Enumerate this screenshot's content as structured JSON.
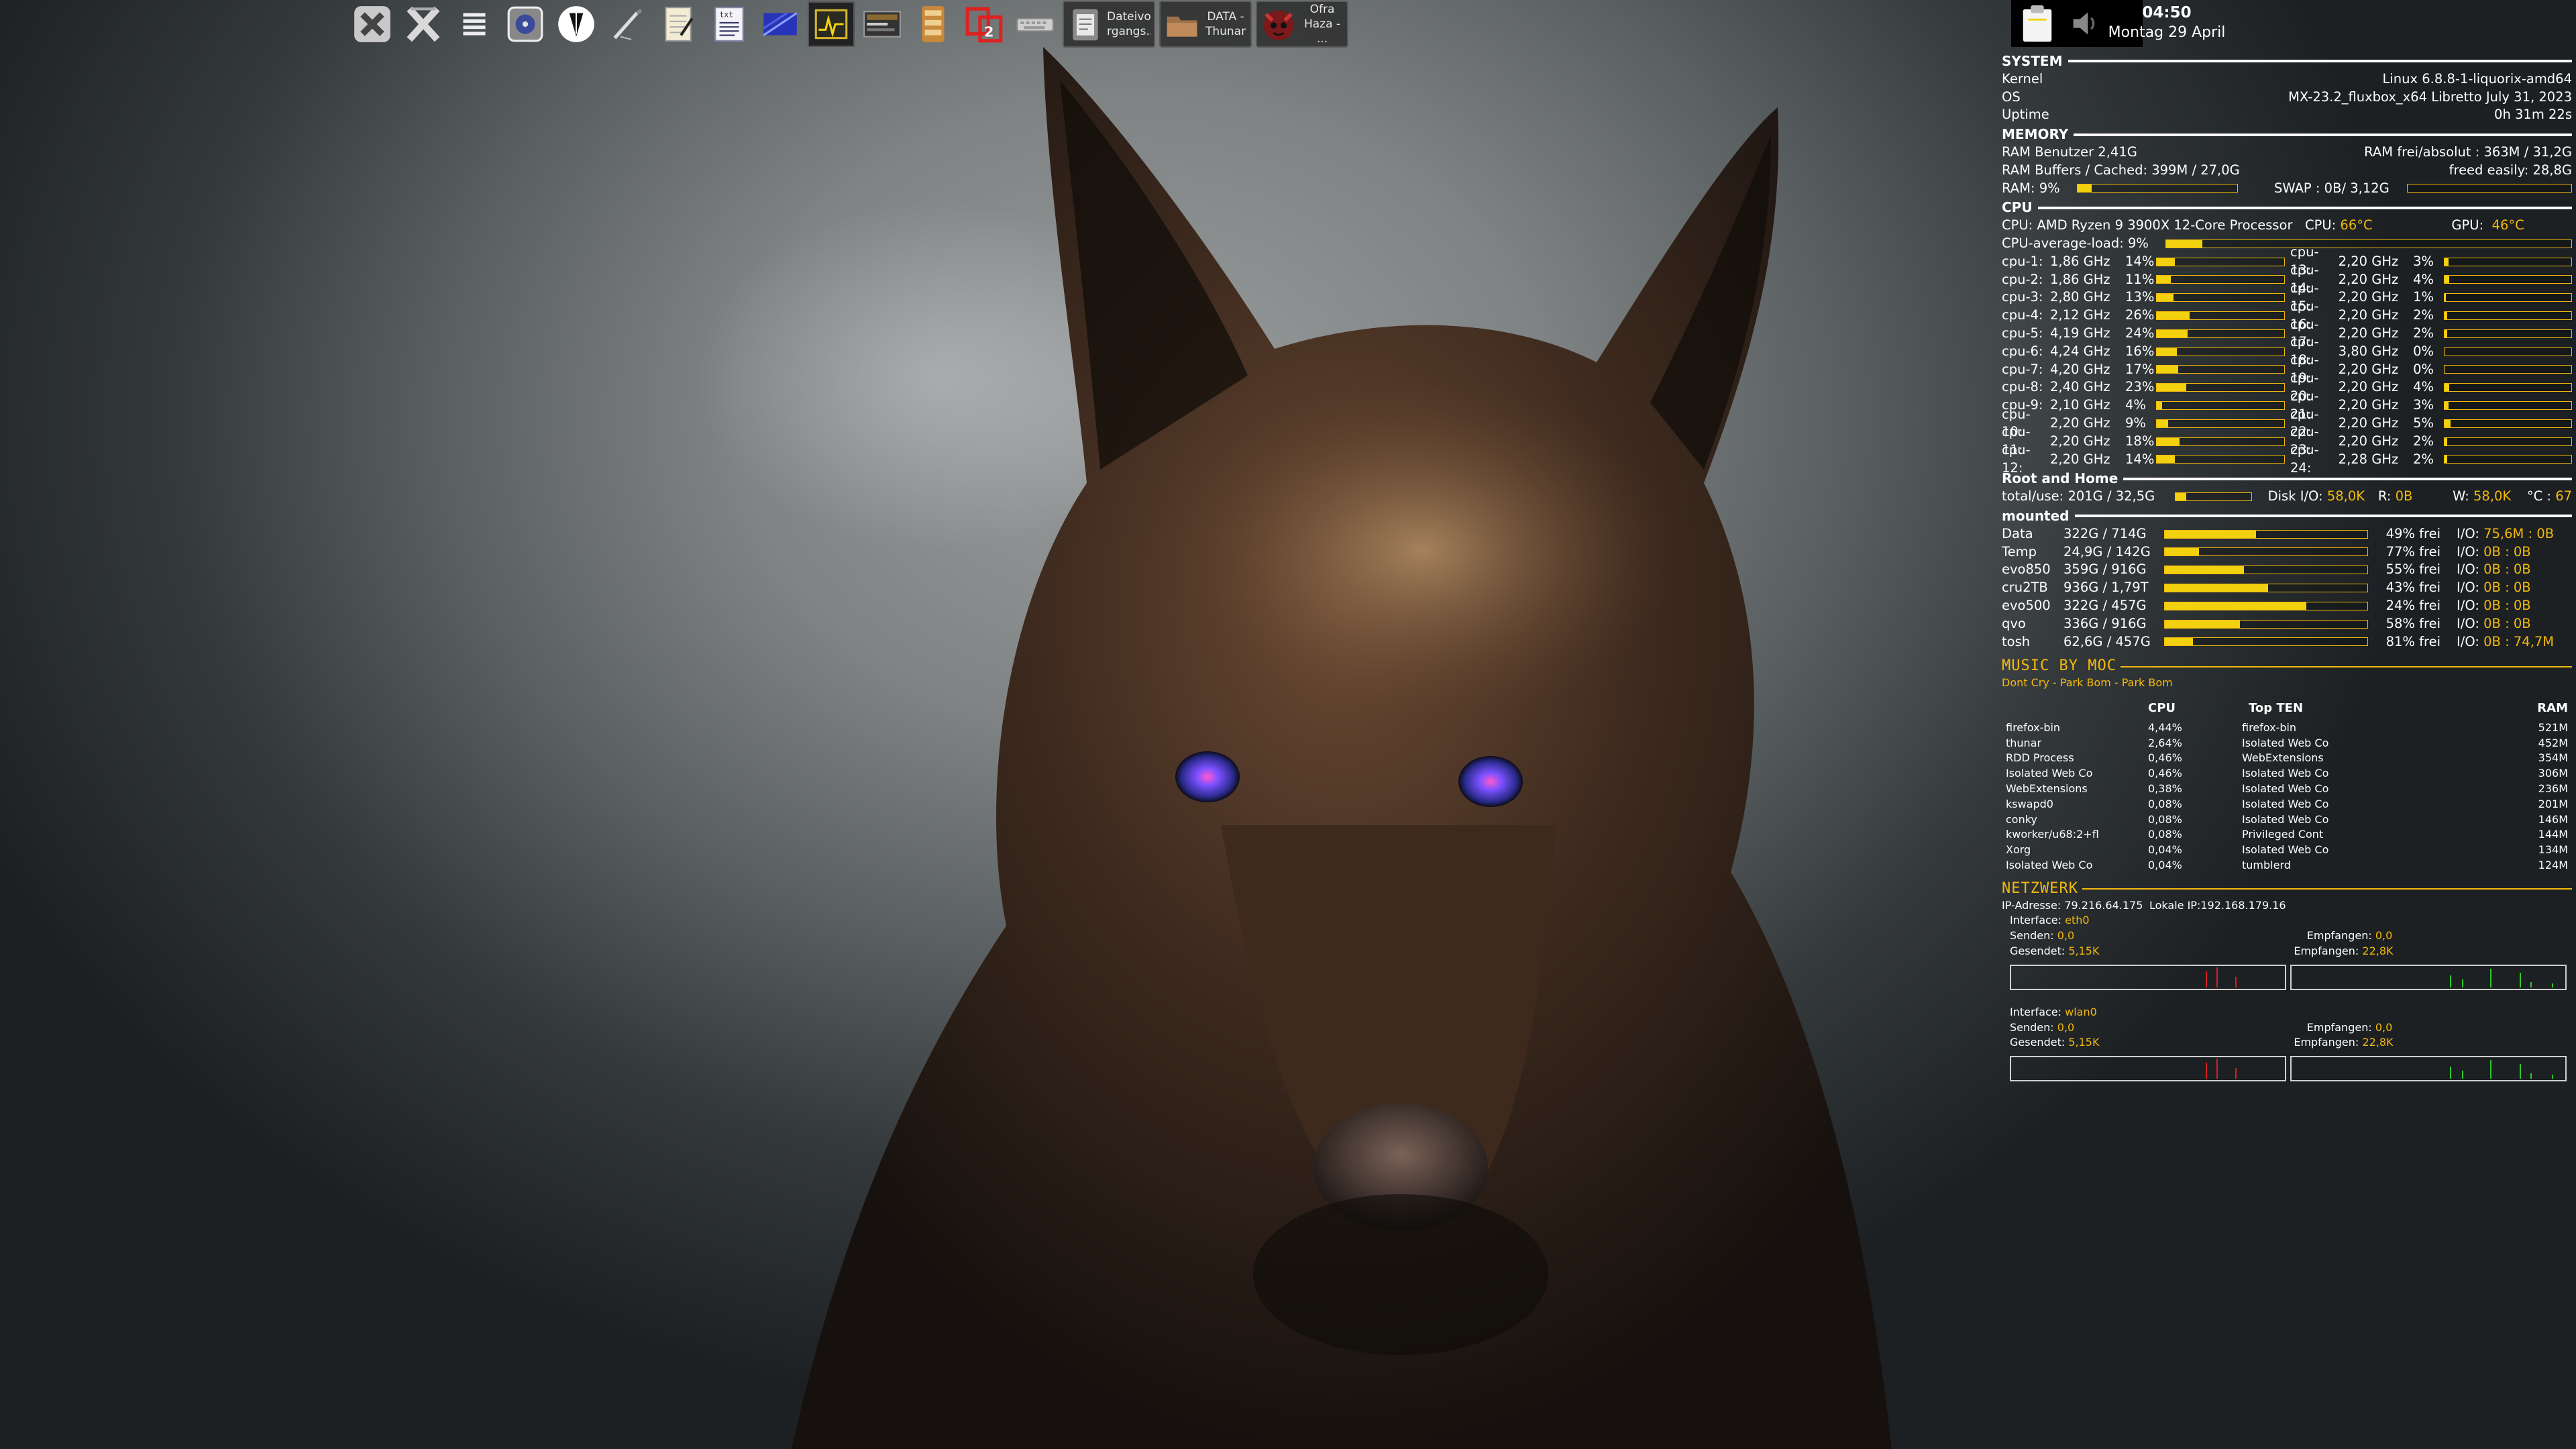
{
  "taskbar": {
    "launchers": [
      "xfce-settings-icon",
      "x-tools-icon",
      "menu-list-icon",
      "media-player-icon",
      "feather-editor-icon",
      "pen-tool-icon",
      "notepad-icon",
      "text-editor-icon",
      "blue-image-icon",
      "system-monitor-icon",
      "terminal-panel-icon",
      "archive-icon",
      "image-editor-icon",
      "keyboard-icon"
    ],
    "tasks": [
      {
        "label": "Dateivo-rgangs...",
        "icon": "file-operations-icon"
      },
      {
        "label": "DATA - Thunar",
        "icon": "folder-icon"
      },
      {
        "label": "Ofra Haza - ...",
        "icon": "music-player-icon"
      }
    ]
  },
  "clock": {
    "time": "04:50",
    "date": "Montag 29 April"
  },
  "conky": {
    "system": {
      "title": "SYSTEM",
      "kernel_label": "Kernel",
      "kernel": "Linux 6.8.8-1-liquorix-amd64",
      "os_label": "OS",
      "os": "MX-23.2_fluxbox_x64 Libretto July 31, 2023",
      "uptime_label": "Uptime",
      "uptime": "0h 31m 22s"
    },
    "memory": {
      "title": "MEMORY",
      "ram_user": "RAM Benutzer 2,41G",
      "ram_free": "RAM frei/absolut : 363M / 31,2G",
      "buffers": "RAM Buffers / Cached: 399M / 27,0G",
      "freed": "freed easily: 28,8G",
      "ram_label": "RAM: 9%",
      "ram_pct": 9,
      "swap_label": "SWAP : 0B/ 3,12G",
      "swap_pct": 0
    },
    "cpu": {
      "title": "CPU",
      "model": "CPU: AMD Ryzen 9 3900X 12-Core Processor",
      "cpu_temp_label": "CPU:",
      "cpu_temp": "66°C",
      "gpu_temp_label": "GPU:",
      "gpu_temp": "46°C",
      "avg_label": "CPU-average-load: 9%",
      "avg_pct": 9,
      "cores": [
        {
          "name": "cpu-1:",
          "freq": "1,86 GHz",
          "pct": 14
        },
        {
          "name": "cpu-13:",
          "freq": "2,20 GHz",
          "pct": 3
        },
        {
          "name": "cpu-2:",
          "freq": "1,86 GHz",
          "pct": 11
        },
        {
          "name": "cpu-14:",
          "freq": "2,20 GHz",
          "pct": 4
        },
        {
          "name": "cpu-3:",
          "freq": "2,80 GHz",
          "pct": 13
        },
        {
          "name": "cpu-15:",
          "freq": "2,20 GHz",
          "pct": 1
        },
        {
          "name": "cpu-4:",
          "freq": "2,12 GHz",
          "pct": 26
        },
        {
          "name": "cpu-16:",
          "freq": "2,20 GHz",
          "pct": 2
        },
        {
          "name": "cpu-5:",
          "freq": "4,19 GHz",
          "pct": 24
        },
        {
          "name": "cpu-17:",
          "freq": "2,20 GHz",
          "pct": 2
        },
        {
          "name": "cpu-6:",
          "freq": "4,24 GHz",
          "pct": 16
        },
        {
          "name": "cpu-18:",
          "freq": "3,80 GHz",
          "pct": 0
        },
        {
          "name": "cpu-7:",
          "freq": "4,20 GHz",
          "pct": 17
        },
        {
          "name": "cpu-19:",
          "freq": "2,20 GHz",
          "pct": 0
        },
        {
          "name": "cpu-8:",
          "freq": "2,40 GHz",
          "pct": 23
        },
        {
          "name": "cpu-20:",
          "freq": "2,20 GHz",
          "pct": 4
        },
        {
          "name": "cpu-9:",
          "freq": "2,10 GHz",
          "pct": 4
        },
        {
          "name": "cpu-21:",
          "freq": "2,20 GHz",
          "pct": 3
        },
        {
          "name": "cpu-10:",
          "freq": "2,20 GHz",
          "pct": 9
        },
        {
          "name": "cpu-22:",
          "freq": "2,20 GHz",
          "pct": 5
        },
        {
          "name": "cpu-11:",
          "freq": "2,20 GHz",
          "pct": 18
        },
        {
          "name": "cpu-23:",
          "freq": "2,20 GHz",
          "pct": 2
        },
        {
          "name": "cpu-12:",
          "freq": "2,20 GHz",
          "pct": 14
        },
        {
          "name": "cpu-24:",
          "freq": "2,28 GHz",
          "pct": 2
        }
      ]
    },
    "root": {
      "title": "Root and Home",
      "total": "total/use: 201G / 32,5G",
      "use_pct": 14,
      "diskio_label": "Disk I/O:",
      "diskio": "58,0K",
      "r_label": "R:",
      "r": "0B",
      "w_label": "W:",
      "w": "58,0K",
      "temp_label": "°C :",
      "temp": "67"
    },
    "mounted": {
      "title": "mounted",
      "disks": [
        {
          "name": "Data",
          "size": "322G / 714G",
          "used_pct": 45,
          "free": "49% frei",
          "io_r": "75,6M",
          "io_w": "0B"
        },
        {
          "name": "Temp",
          "size": "24,9G / 142G",
          "used_pct": 17,
          "free": "77% frei",
          "io_r": "0B",
          "io_w": "0B"
        },
        {
          "name": "evo850",
          "size": "359G / 916G",
          "used_pct": 39,
          "free": "55% frei",
          "io_r": "0B",
          "io_w": "0B"
        },
        {
          "name": "cru2TB",
          "size": "936G / 1,79T",
          "used_pct": 51,
          "free": "43% frei",
          "io_r": "0B",
          "io_w": "0B"
        },
        {
          "name": "evo500",
          "size": "322G / 457G",
          "used_pct": 70,
          "free": "24% frei",
          "io_r": "0B",
          "io_w": "0B"
        },
        {
          "name": "qvo",
          "size": "336G / 916G",
          "used_pct": 37,
          "free": "58% frei",
          "io_r": "0B",
          "io_w": "0B"
        },
        {
          "name": "tosh",
          "size": "62,6G / 457G",
          "used_pct": 14,
          "free": "81% frei",
          "io_r": "0B",
          "io_w": "74,7M"
        }
      ],
      "io_label": "I/O:"
    },
    "music": {
      "title": "MUSIC BY MOC",
      "track": "Dont Cry - Park Bom - Park Bom"
    },
    "top": {
      "cpu_header": "CPU",
      "title": "Top TEN",
      "ram_header": "RAM",
      "cpu_rows": [
        [
          "firefox-bin",
          "4,44%"
        ],
        [
          "thunar",
          "2,64%"
        ],
        [
          "RDD Process",
          "0,46%"
        ],
        [
          "Isolated Web Co",
          "0,46%"
        ],
        [
          "WebExtensions",
          "0,38%"
        ],
        [
          "kswapd0",
          "0,08%"
        ],
        [
          "conky",
          "0,08%"
        ],
        [
          "kworker/u68:2+fl",
          "0,08%"
        ],
        [
          "Xorg",
          "0,04%"
        ],
        [
          "Isolated Web Co",
          "0,04%"
        ]
      ],
      "ram_rows": [
        [
          "firefox-bin",
          "521M"
        ],
        [
          "Isolated Web Co",
          "452M"
        ],
        [
          "WebExtensions",
          "354M"
        ],
        [
          "Isolated Web Co",
          "306M"
        ],
        [
          "Isolated Web Co",
          "236M"
        ],
        [
          "Isolated Web Co",
          "201M"
        ],
        [
          "Isolated Web Co",
          "146M"
        ],
        [
          "Privileged Cont",
          "144M"
        ],
        [
          "Isolated Web Co",
          "134M"
        ],
        [
          "tumblerd",
          "124M"
        ]
      ]
    },
    "network": {
      "title": "NETZWERK",
      "ip": "IP-Adresse: 79.216.64.175",
      "local_ip": "Lokale IP:192.168.179.16",
      "interfaces": [
        {
          "label": "Interface:",
          "name": "eth0",
          "sent_label": "Senden:",
          "sent": "0,0",
          "total_sent_label": "Gesendet:",
          "total_sent": "5,15K",
          "recv_label": "Empfangen:",
          "recv": "0,0",
          "total_recv_label": "Empfangen:",
          "total_recv": "22,8K"
        },
        {
          "label": "Interface:",
          "name": "wlan0",
          "sent_label": "Senden:",
          "sent": "0,0",
          "total_sent_label": "Gesendet:",
          "total_sent": "5,15K",
          "recv_label": "Empfangen:",
          "recv": "0,0",
          "total_recv_label": "Empfangen:",
          "total_recv": "22,8K"
        }
      ]
    }
  },
  "colors": {
    "accent": "#f2b90f",
    "bar": "#f2d10f",
    "text": "#ffffff",
    "graph_send": "#d22020",
    "graph_recv": "#2ec82e"
  }
}
